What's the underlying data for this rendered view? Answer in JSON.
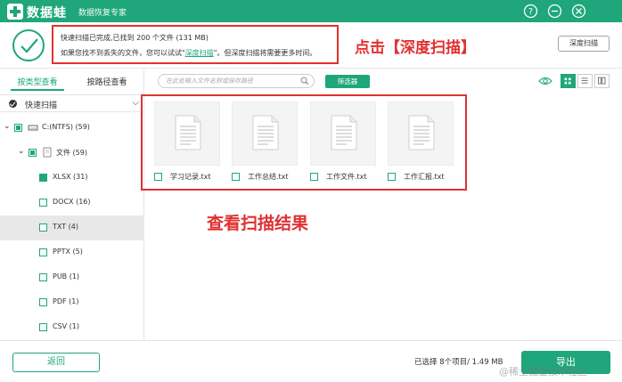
{
  "titlebar": {
    "app_name": "数据蛙",
    "subtitle": "数据恢复专家",
    "help_icon": "question-circle-icon",
    "min_icon": "minimize-icon",
    "close_icon": "close-icon",
    "brand_color": "#1fa67a"
  },
  "info": {
    "line1": "快速扫描已完成,已找到 200 个文件 (131 MB)",
    "line2_prefix": "如果您找不到丢失的文件，您可以试试\"",
    "line2_link": "深度扫描",
    "line2_suffix": "\"。但深度扫描将需要更多时间。",
    "deep_scan_button": "深度扫描"
  },
  "annotations": {
    "top": "点击【深度扫描】",
    "middle": "查看扫描结果",
    "color": "#e03131"
  },
  "sidebar": {
    "tabs": [
      "按类型查看",
      "按路径查看"
    ],
    "active_tab": "按类型查看",
    "scan_mode": "快速扫描",
    "tree": [
      {
        "label": "C:(NTFS) (59)",
        "level": 0,
        "check": "partial",
        "expanded": true,
        "icon": "drive-icon"
      },
      {
        "label": "文件 (59)",
        "level": 1,
        "check": "partial",
        "expanded": true,
        "icon": "file-folder-icon"
      },
      {
        "label": "XLSX (31)",
        "level": 2,
        "check": "full"
      },
      {
        "label": "DOCX (16)",
        "level": 2,
        "check": "none"
      },
      {
        "label": "TXT (4)",
        "level": 2,
        "check": "none",
        "selected": true
      },
      {
        "label": "PPTX (5)",
        "level": 2,
        "check": "none"
      },
      {
        "label": "PUB (1)",
        "level": 2,
        "check": "none"
      },
      {
        "label": "PDF (1)",
        "level": 2,
        "check": "none"
      },
      {
        "label": "CSV (1)",
        "level": 2,
        "check": "none"
      }
    ]
  },
  "main": {
    "search_placeholder": "在此处输入文件名称或保存路径",
    "filter_button": "筛选器",
    "files": [
      {
        "name": "学习记录.txt"
      },
      {
        "name": "工作总结.txt"
      },
      {
        "name": "工作文件.txt"
      },
      {
        "name": "工作汇报.txt"
      }
    ]
  },
  "bottombar": {
    "back_button": "返回",
    "selection_info": "已选择 8个项目/ 1.49 MB",
    "export_button": "导出",
    "watermark": "@稀土掘金技术社区"
  }
}
